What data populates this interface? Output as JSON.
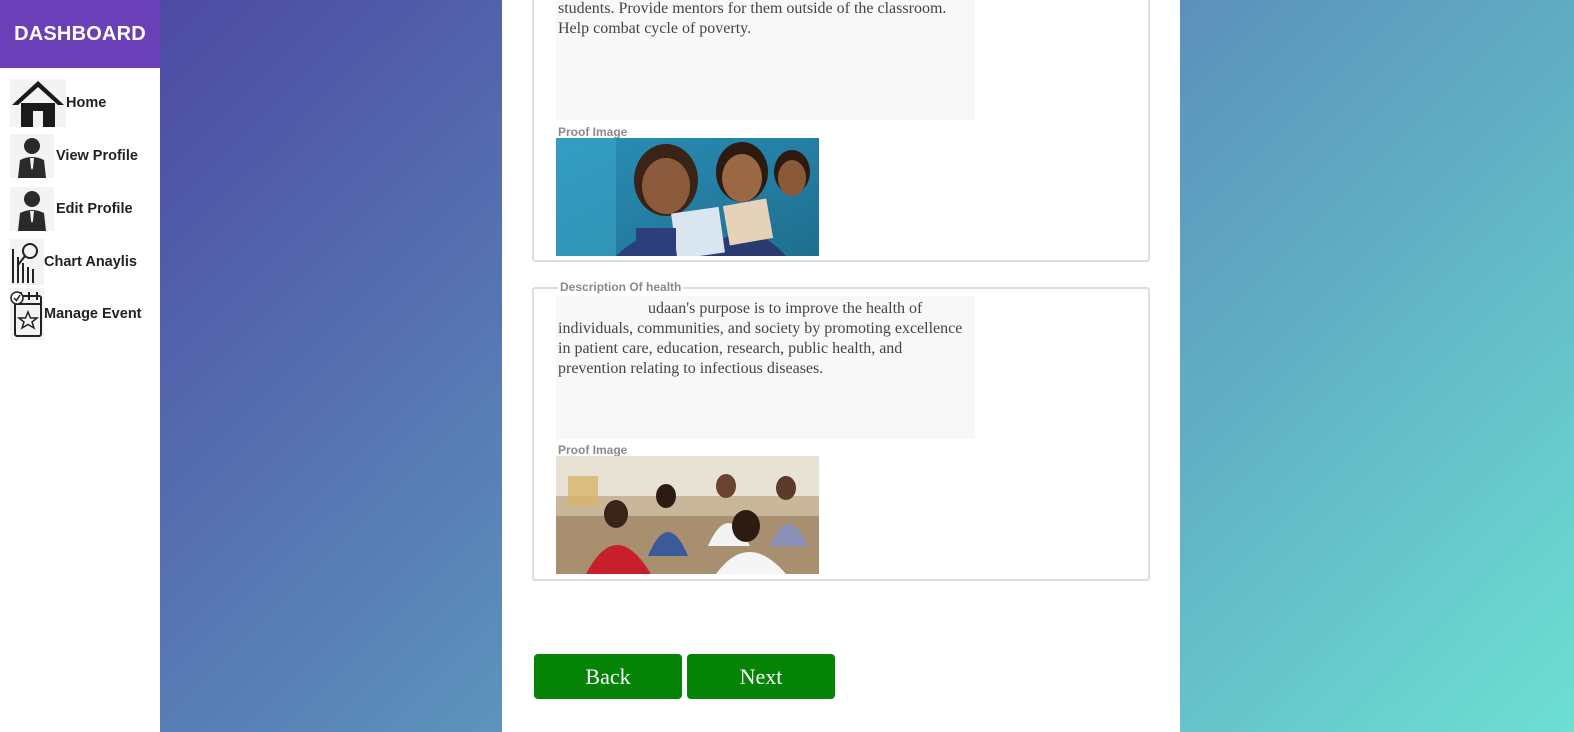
{
  "sidebar": {
    "title": "DASHBOARD",
    "items": [
      {
        "label": "Home",
        "icon": "home-icon"
      },
      {
        "label": "View Profile",
        "icon": "user-icon"
      },
      {
        "label": "Edit Profile",
        "icon": "user-icon"
      },
      {
        "label": "Chart Anaylis",
        "icon": "chart-analysis-icon"
      },
      {
        "label": "Manage Event",
        "icon": "calendar-event-icon"
      }
    ]
  },
  "sections": [
    {
      "legend": "",
      "description": "students. Provide mentors for them outside of the classroom. Help combat cycle of poverty.",
      "proof_label": "Proof Image",
      "image": "children-smiling-with-books-photo"
    },
    {
      "legend": "Description Of health",
      "description": "udaan's purpose is to improve the health of individuals, communities, and society by promoting excellence in patient care, education, research, public health, and prevention relating to infectious diseases.",
      "proof_label": "Proof Image",
      "image": "health-checkup-camp-photo"
    }
  ],
  "buttons": {
    "back": "Back",
    "next": "Next"
  },
  "colors": {
    "brand": "#6a3fb8",
    "button": "#058405"
  }
}
